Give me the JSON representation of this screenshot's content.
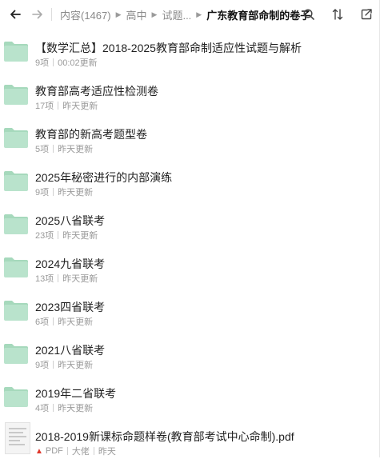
{
  "breadcrumb": {
    "items": [
      "内容(1467)",
      "高中",
      "试题...",
      "广东教育部命制的卷子"
    ]
  },
  "colors": {
    "folder": "#b9e3cc",
    "folder_tab": "#a6d9bc",
    "pdf_badge": "#e0372b"
  },
  "folders": [
    {
      "name": "【数学汇总】2018-2025教育部命制适应性试题与解析",
      "count": "9项",
      "updated": "00:02更新"
    },
    {
      "name": "教育部高考适应性检测卷",
      "count": "17项",
      "updated": "昨天更新"
    },
    {
      "name": "教育部的新高考题型卷",
      "count": "5项",
      "updated": "昨天更新"
    },
    {
      "name": "2025年秘密进行的内部演练",
      "count": "9项",
      "updated": "昨天更新"
    },
    {
      "name": "2025八省联考",
      "count": "23项",
      "updated": "昨天更新"
    },
    {
      "name": "2024九省联考",
      "count": "13项",
      "updated": "昨天更新"
    },
    {
      "name": "2023四省联考",
      "count": "6项",
      "updated": "昨天更新"
    },
    {
      "name": "2021八省联考",
      "count": "9项",
      "updated": "昨天更新"
    },
    {
      "name": "2019年二省联考",
      "count": "4项",
      "updated": "昨天更新"
    }
  ],
  "file": {
    "name": "2018-2019新课标命题样卷(教育部考试中心命制).pdf",
    "type": "PDF",
    "author": "大佬",
    "updated": "昨天"
  }
}
